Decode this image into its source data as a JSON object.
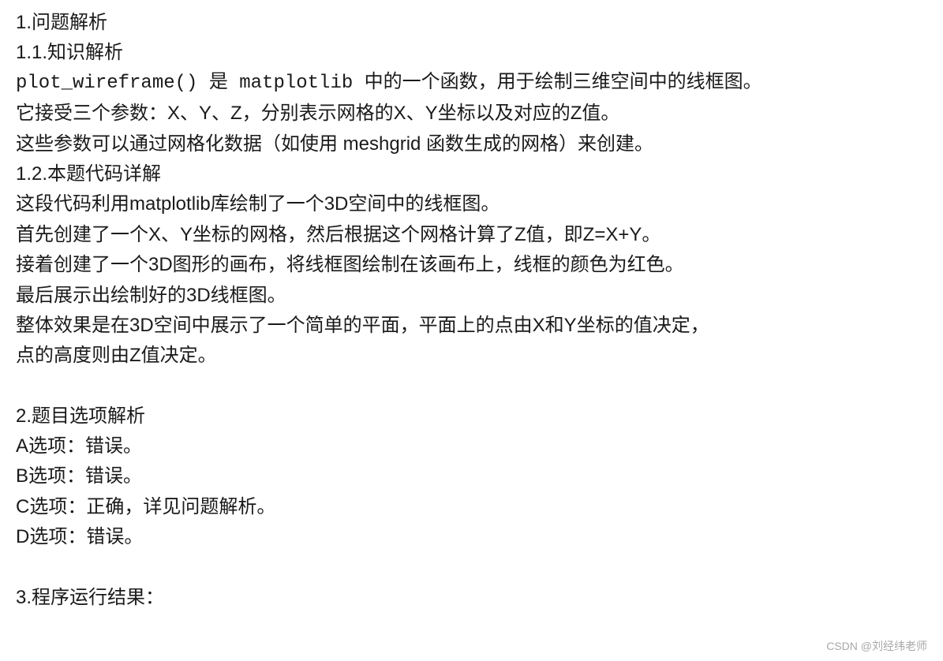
{
  "lines": [
    "1.问题解析",
    "1.1.知识解析",
    "plot_wireframe() 是 matplotlib 中的一个函数，用于绘制三维空间中的线框图。",
    "它接受三个参数：X、Y、Z，分别表示网格的X、Y坐标以及对应的Z值。",
    "这些参数可以通过网格化数据（如使用 meshgrid 函数生成的网格）来创建。",
    "1.2.本题代码详解",
    "这段代码利用matplotlib库绘制了一个3D空间中的线框图。",
    "首先创建了一个X、Y坐标的网格，然后根据这个网格计算了Z值，即Z=X+Y。",
    "接着创建了一个3D图形的画布，将线框图绘制在该画布上，线框的颜色为红色。",
    "最后展示出绘制好的3D线框图。",
    "整体效果是在3D空间中展示了一个简单的平面，平面上的点由X和Y坐标的值决定，",
    "点的高度则由Z值决定。",
    "",
    "2.题目选项解析",
    "A选项：错误。",
    "B选项：错误。",
    "C选项：正确，详见问题解析。",
    "D选项：错误。",
    "",
    "3.程序运行结果："
  ],
  "watermark": "CSDN @刘经纬老师"
}
